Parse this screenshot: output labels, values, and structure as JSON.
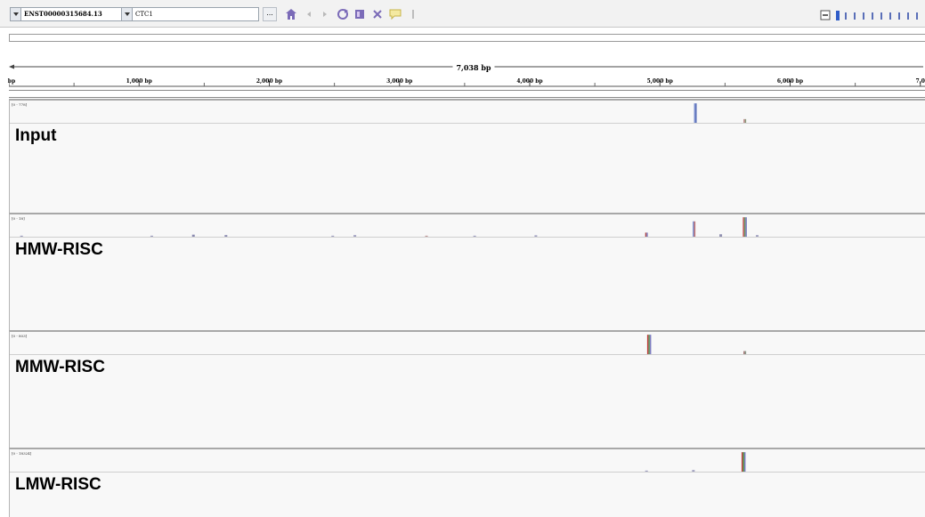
{
  "toolbar": {
    "genome_value": "ENST00000315684.13",
    "locus_value": "CTC1",
    "ellipsis_label": "...",
    "icons": [
      "home-icon",
      "back-icon",
      "forward-icon",
      "refresh-icon",
      "roi-icon",
      "close-icon",
      "popup-text-icon",
      "separator"
    ],
    "zoom_levels": 10,
    "zoom_level_selected": 1
  },
  "ruler": {
    "span_label": "7,038 bp",
    "ticks": [
      {
        "label": "bp",
        "pos": 0
      },
      {
        "label": "1,000 bp",
        "pos": 1000
      },
      {
        "label": "2,000 bp",
        "pos": 2000
      },
      {
        "label": "3,000 bp",
        "pos": 3000
      },
      {
        "label": "4,000 bp",
        "pos": 4000
      },
      {
        "label": "5,000 bp",
        "pos": 5000
      },
      {
        "label": "6,000 bp",
        "pos": 6000
      },
      {
        "label": "7,0",
        "pos": 7000
      }
    ],
    "extent_bp": 7038
  },
  "tracks": [
    {
      "name": "Input",
      "range": "[0 - 778]",
      "peaks": [
        {
          "bp": 5255,
          "height": 0.95,
          "colors": [
            "#7b8fcf",
            "#5a6fb8"
          ]
        },
        {
          "bp": 5635,
          "height": 0.18,
          "colors": [
            "#c08a8a",
            "#8a9a7a"
          ]
        }
      ]
    },
    {
      "name": "HMW-RISC",
      "range": "[0 - 18]",
      "peaks": [
        {
          "bp": 80,
          "height": 0.05,
          "colors": [
            "#a0a0c0"
          ]
        },
        {
          "bp": 1080,
          "height": 0.05,
          "colors": [
            "#a0a0c0"
          ]
        },
        {
          "bp": 1400,
          "height": 0.1,
          "colors": [
            "#8a8ab0"
          ]
        },
        {
          "bp": 1650,
          "height": 0.08,
          "colors": [
            "#8a8ab0"
          ]
        },
        {
          "bp": 2470,
          "height": 0.05,
          "colors": [
            "#a0a0c0"
          ]
        },
        {
          "bp": 2640,
          "height": 0.08,
          "colors": [
            "#a0a0c0"
          ]
        },
        {
          "bp": 3190,
          "height": 0.05,
          "colors": [
            "#c09a9a"
          ]
        },
        {
          "bp": 3560,
          "height": 0.05,
          "colors": [
            "#a0a0c0"
          ]
        },
        {
          "bp": 4030,
          "height": 0.07,
          "colors": [
            "#a0a0c0"
          ]
        },
        {
          "bp": 4880,
          "height": 0.2,
          "colors": [
            "#b04848",
            "#7f7fbf"
          ]
        },
        {
          "bp": 5245,
          "height": 0.75,
          "colors": [
            "#7b8fcf",
            "#c07070"
          ]
        },
        {
          "bp": 5450,
          "height": 0.12,
          "colors": [
            "#9090b0"
          ]
        },
        {
          "bp": 5630,
          "height": 0.95,
          "colors": [
            "#c05050",
            "#6a9a6a",
            "#7b7bc0"
          ]
        },
        {
          "bp": 5730,
          "height": 0.08,
          "colors": [
            "#a0a0c0"
          ]
        }
      ]
    },
    {
      "name": "MMW-RISC",
      "range": "[0 - 803]",
      "peaks": [
        {
          "bp": 4895,
          "height": 0.95,
          "colors": [
            "#c03c3c",
            "#5a9a5a",
            "#7b7bc0"
          ]
        },
        {
          "bp": 5635,
          "height": 0.15,
          "colors": [
            "#a07070",
            "#8a9a8a"
          ]
        }
      ]
    },
    {
      "name": "LMW-RISC",
      "range": "[0 - 18324]",
      "peaks": [
        {
          "bp": 4880,
          "height": 0.05,
          "colors": [
            "#a0a0c0"
          ]
        },
        {
          "bp": 5240,
          "height": 0.08,
          "colors": [
            "#a0a0c0"
          ]
        },
        {
          "bp": 5620,
          "height": 0.95,
          "colors": [
            "#c04040",
            "#4a9a4a",
            "#7b7bc0"
          ]
        }
      ]
    }
  ]
}
